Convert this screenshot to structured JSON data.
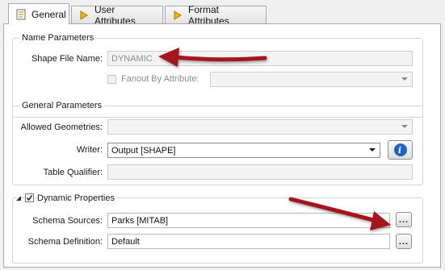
{
  "tabs": [
    {
      "label": "General",
      "icon": "parameters-icon",
      "active": true
    },
    {
      "label": "User Attributes",
      "icon": "diamond-icon",
      "active": false
    },
    {
      "label": "Format Attributes",
      "icon": "diamond-icon",
      "active": false
    }
  ],
  "name_parameters": {
    "title": "Name Parameters",
    "shape_file_name_label": "Shape File Name:",
    "shape_file_name_value": "DYNAMIC",
    "fanout_label": "Fanout By Attribute:",
    "fanout_value": ""
  },
  "general_parameters": {
    "title": "General Parameters",
    "allowed_geometries_label": "Allowed Geometries:",
    "allowed_geometries_value": "",
    "writer_label": "Writer:",
    "writer_value": "Output [SHAPE]",
    "table_qualifier_label": "Table Qualifier:",
    "table_qualifier_value": ""
  },
  "dynamic_properties": {
    "title": "Dynamic Properties",
    "checked": true,
    "schema_sources_label": "Schema Sources:",
    "schema_sources_value": "Parks [MITAB]",
    "schema_definition_label": "Schema Definition:",
    "schema_definition_value": "Default",
    "browse_label": "..."
  },
  "colors": {
    "arrow": "#a3161a",
    "info_button": "#1e63c4"
  }
}
